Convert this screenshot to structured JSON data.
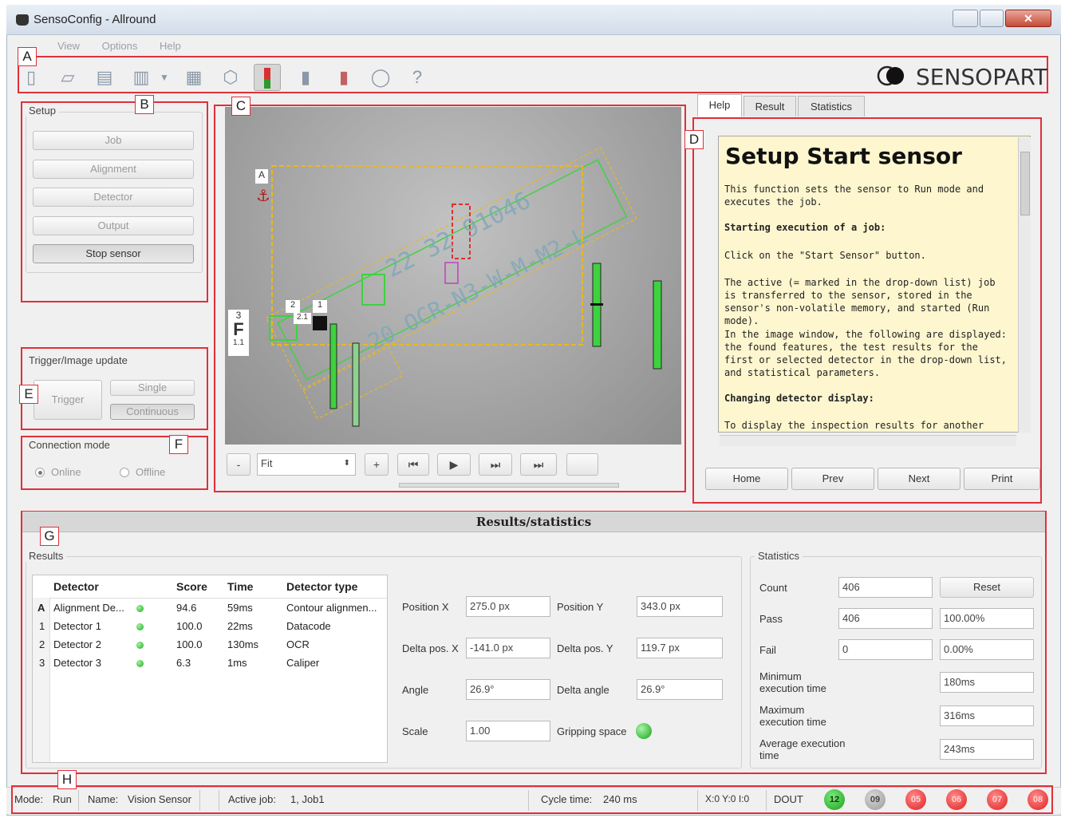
{
  "window": {
    "title": "SensoConfig - Allround"
  },
  "menu": [
    "View",
    "Options",
    "Help"
  ],
  "brand": {
    "logo_text": "SENSOPART"
  },
  "callouts": {
    "A": "A",
    "B": "B",
    "C": "C",
    "D": "D",
    "E": "E",
    "F": "F",
    "G": "G",
    "H": "H"
  },
  "setup": {
    "title": "Setup",
    "buttons": [
      "Job",
      "Alignment",
      "Detector",
      "Output",
      "Stop sensor"
    ]
  },
  "trigger": {
    "title": "Trigger/Image update",
    "trigger_label": "Trigger",
    "single_label": "Single",
    "continuous_label": "Continuous"
  },
  "connection": {
    "title": "Connection mode",
    "online": "Online",
    "offline": "Offline"
  },
  "image": {
    "zoom_minus": "-",
    "zoom_value": "Fit",
    "zoom_plus": "+",
    "overlay_labels": {
      "a": "A",
      "three": "3",
      "f": "F",
      "f_sub": "1.1",
      "two": "2",
      "two_one": "2.1",
      "one": "1",
      "text_line1": "22 32 91046",
      "text_line2": "20 OCR-N3-W-M-M2-L"
    }
  },
  "help": {
    "tabs": [
      "Help",
      "Result",
      "Statistics"
    ],
    "title": "Setup Start sensor",
    "p1": "This function sets the sensor to Run mode and executes the job.",
    "h1": "Starting execution of a job:",
    "p2": "Click on the \"Start Sensor\" button.",
    "p3": "The active (= marked in the drop-down list) job is transferred to the sensor, stored in the sensor's non-volatile memory, and started (Run mode).",
    "p4": "In the image window, the following are displayed: the found features, the test results for the first or selected detector in the drop-down list, and statistical parameters.",
    "h2": "Changing detector display:",
    "p5": "To display the inspection results for another",
    "nav": [
      "Home",
      "Prev",
      "Next",
      "Print"
    ]
  },
  "results": {
    "header": "Results/statistics",
    "results_title": "Results",
    "columns": [
      "Detector",
      "Score",
      "Time",
      "Detector type"
    ],
    "rows": [
      {
        "id": "A",
        "detector": "Alignment De...",
        "score": "94.6",
        "time": "59ms",
        "type": "Contour alignmen..."
      },
      {
        "id": "1",
        "detector": "Detector 1",
        "score": "100.0",
        "time": "22ms",
        "type": "Datacode"
      },
      {
        "id": "2",
        "detector": "Detector 2",
        "score": "100.0",
        "time": "130ms",
        "type": "OCR"
      },
      {
        "id": "3",
        "detector": "Detector 3",
        "score": "6.3",
        "time": "1ms",
        "type": "Caliper"
      }
    ],
    "fields": {
      "pos_x_label": "Position X",
      "pos_x": "275.0 px",
      "pos_y_label": "Position Y",
      "pos_y": "343.0 px",
      "dpos_x_label": "Delta pos. X",
      "dpos_x": "-141.0 px",
      "dpos_y_label": "Delta pos. Y",
      "dpos_y": "119.7 px",
      "angle_label": "Angle",
      "angle": "26.9°",
      "dangle_label": "Delta angle",
      "dangle": "26.9°",
      "scale_label": "Scale",
      "scale": "1.00",
      "gripping_label": "Gripping space"
    }
  },
  "statistics": {
    "title": "Statistics",
    "count_label": "Count",
    "count": "406",
    "reset": "Reset",
    "pass_label": "Pass",
    "pass": "406",
    "pass_pct": "100.00%",
    "fail_label": "Fail",
    "fail": "0",
    "fail_pct": "0.00%",
    "min_label": "Minimum execution time",
    "min": "180ms",
    "max_label": "Maximum execution time",
    "max": "316ms",
    "avg_label": "Average execution time",
    "avg": "243ms"
  },
  "status": {
    "mode": "Mode:",
    "mode_val": "Run",
    "name": "Name:",
    "name_val": "Vision Sensor",
    "job": "Active job:",
    "job_val": "1, Job1",
    "cycle": "Cycle time:",
    "cycle_val": "240 ms",
    "xy": "X:0 Y:0 I:0",
    "dout": "DOUT",
    "leds": [
      "12",
      "09",
      "05",
      "06",
      "07",
      "08"
    ]
  },
  "colors": {
    "callout_red": "#e0303a",
    "yellow_overlay": "#e8b820",
    "green_overlay": "#3ed23e",
    "help_bg": "#fdf6cf"
  }
}
